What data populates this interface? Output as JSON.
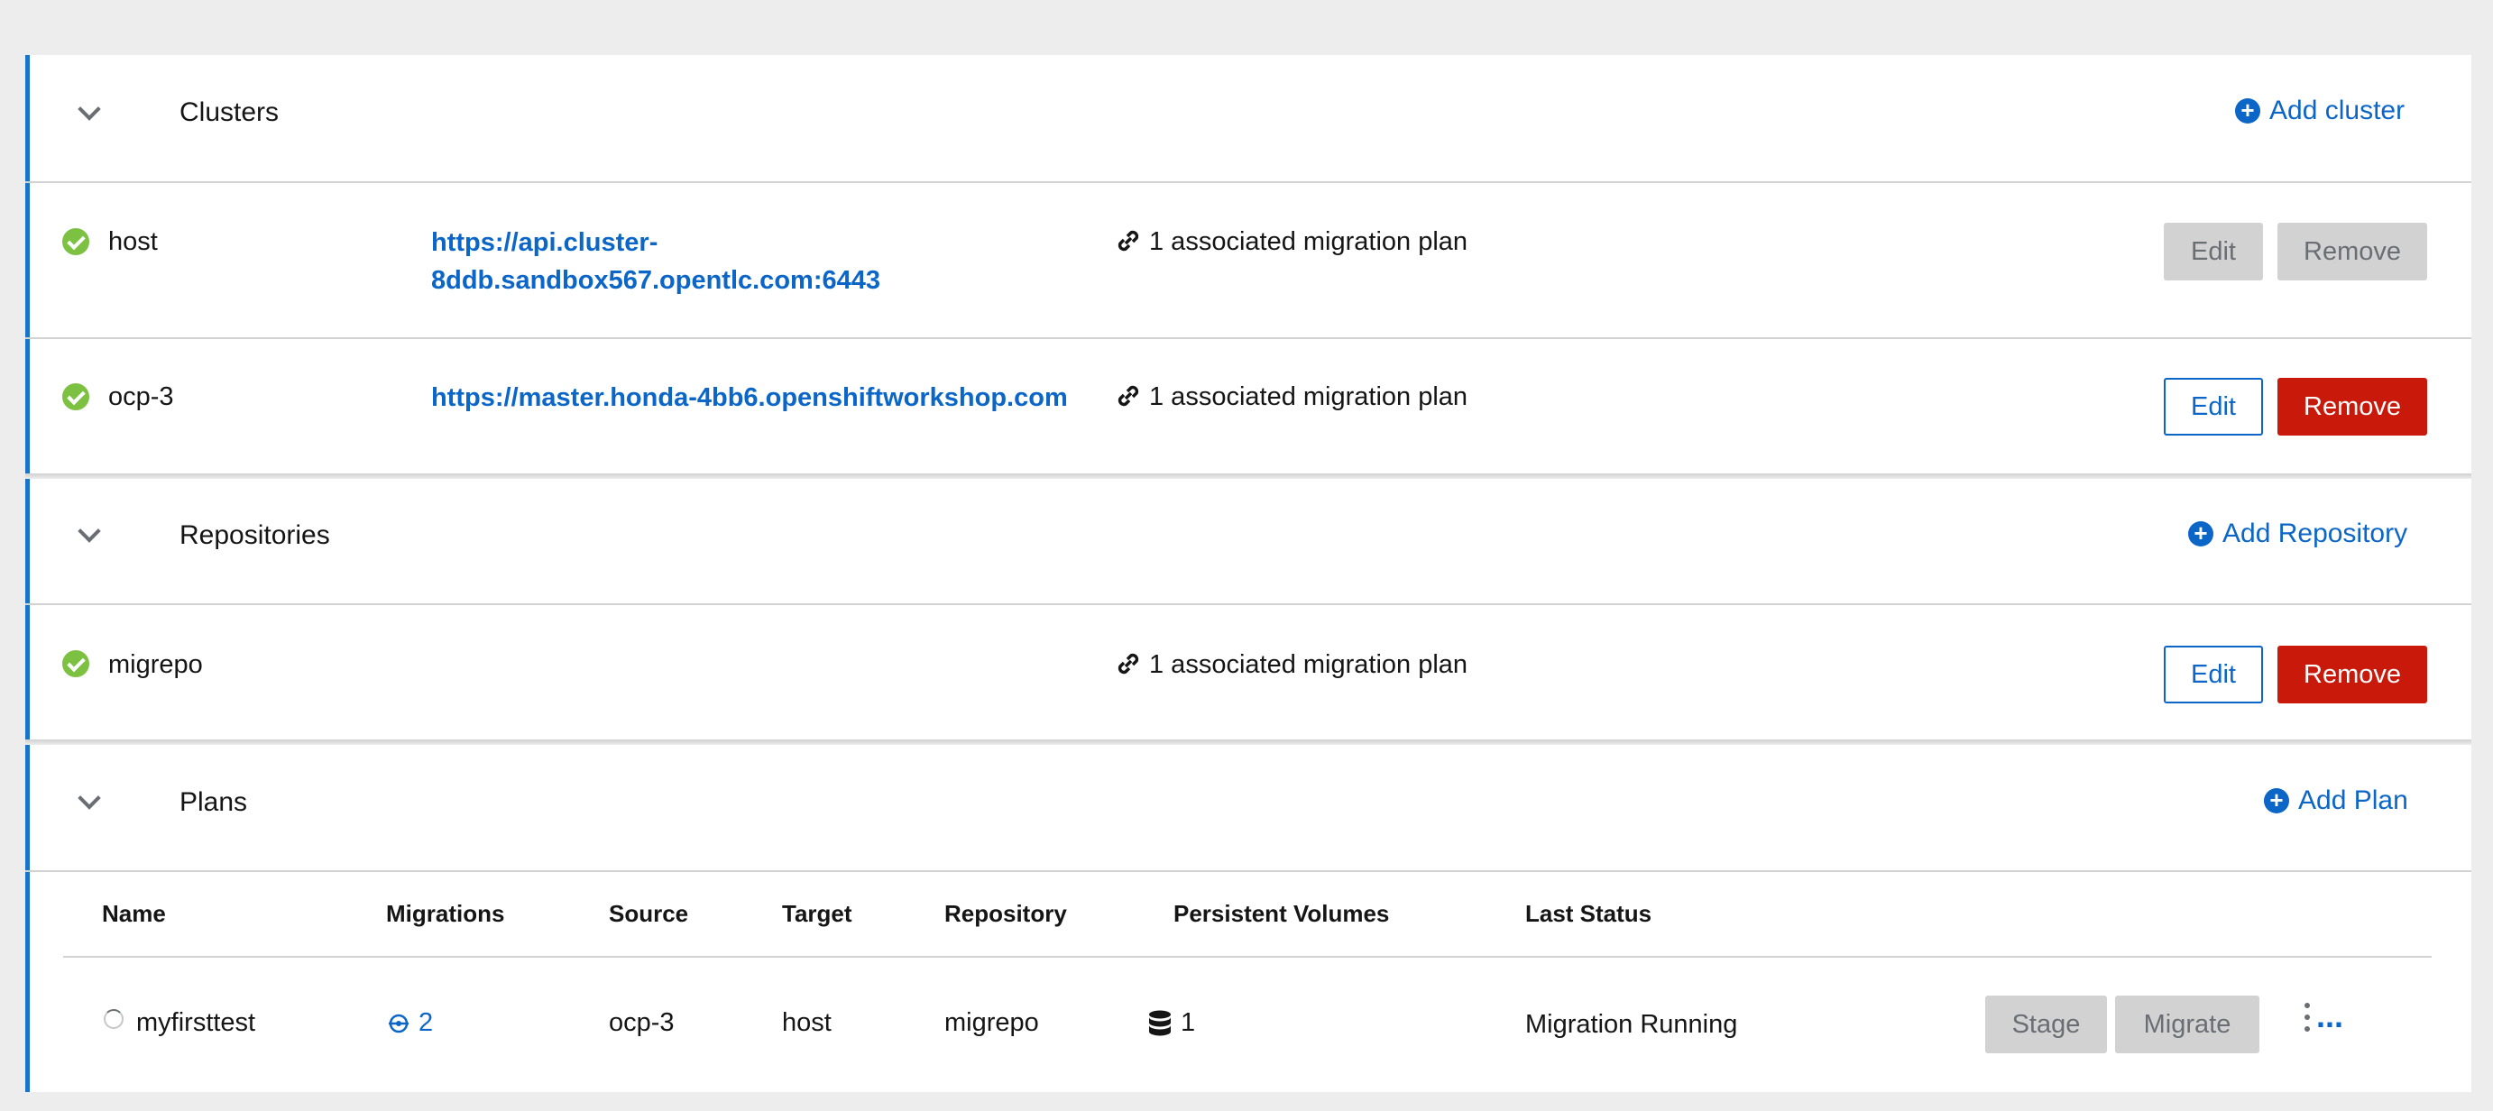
{
  "clusters": {
    "title": "Clusters",
    "add_label": "Add cluster",
    "items": [
      {
        "name": "host",
        "url_line1": "https://api.cluster-",
        "url_line2": "8ddb.sandbox567.opentlc.com:6443",
        "plans": "1 associated migration plan",
        "edit_label": "Edit",
        "remove_label": "Remove",
        "disabled": true
      },
      {
        "name": "ocp-3",
        "url_line1": "https://master.honda-4bb6.openshiftworkshop.com",
        "url_line2": "",
        "plans": "1 associated migration plan",
        "edit_label": "Edit",
        "remove_label": "Remove",
        "disabled": false
      }
    ]
  },
  "repositories": {
    "title": "Repositories",
    "add_label": "Add Repository",
    "items": [
      {
        "name": "migrepo",
        "plans": "1 associated migration plan",
        "edit_label": "Edit",
        "remove_label": "Remove"
      }
    ]
  },
  "plans": {
    "title": "Plans",
    "add_label": "Add Plan",
    "columns": [
      "Name",
      "Migrations",
      "Source",
      "Target",
      "Repository",
      "Persistent Volumes",
      "Last Status"
    ],
    "rows": [
      {
        "name": "myfirsttest",
        "migrations": "2",
        "source": "ocp-3",
        "target": "host",
        "repository": "migrepo",
        "pvs": "1",
        "status": "Migration Running",
        "stage_label": "Stage",
        "migrate_label": "Migrate",
        "more_label": "..."
      }
    ]
  },
  "colors": {
    "accent": "#0b66c7",
    "danger": "#c9190b",
    "success": "#7dc143",
    "border": "#1a73c8"
  }
}
